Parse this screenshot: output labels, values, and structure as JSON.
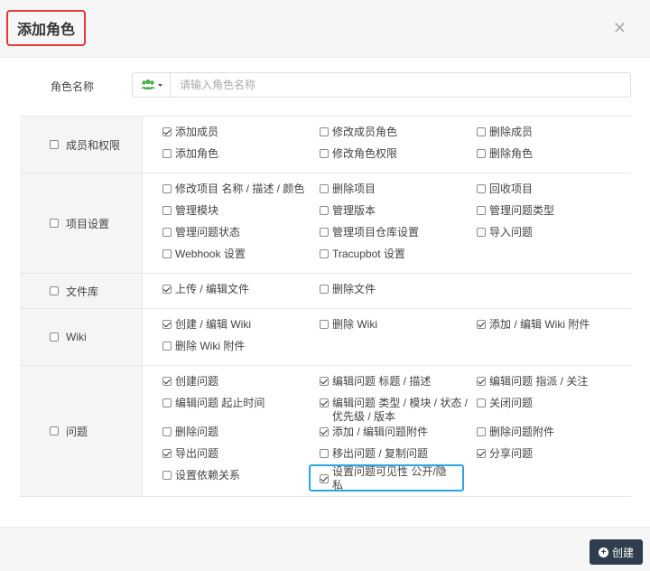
{
  "dialog": {
    "title": "添加角色",
    "close_glyph": "✕",
    "role_name_label": "角色名称",
    "role_name_value": "",
    "role_name_placeholder": "请输入角色名称",
    "icon_color": "#4caf50",
    "create_label": "创建"
  },
  "permissions": [
    {
      "category": "成员和权限",
      "checked": false,
      "items": [
        {
          "label": "添加成员",
          "checked": true
        },
        {
          "label": "修改成员角色",
          "checked": false
        },
        {
          "label": "删除成员",
          "checked": false
        },
        {
          "label": "添加角色",
          "checked": false
        },
        {
          "label": "修改角色权限",
          "checked": false
        },
        {
          "label": "删除角色",
          "checked": false
        }
      ]
    },
    {
      "category": "项目设置",
      "checked": false,
      "items": [
        {
          "label": "修改项目 名称 / 描述 / 颜色",
          "checked": false
        },
        {
          "label": "删除项目",
          "checked": false
        },
        {
          "label": "回收项目",
          "checked": false
        },
        {
          "label": "管理模块",
          "checked": false
        },
        {
          "label": "管理版本",
          "checked": false
        },
        {
          "label": "管理问题类型",
          "checked": false
        },
        {
          "label": "管理问题状态",
          "checked": false
        },
        {
          "label": "管理项目仓库设置",
          "checked": false
        },
        {
          "label": "导入问题",
          "checked": false
        },
        {
          "label": "Webhook 设置",
          "checked": false
        },
        {
          "label": "Tracupbot 设置",
          "checked": false
        }
      ]
    },
    {
      "category": "文件库",
      "checked": false,
      "items": [
        {
          "label": "上传 / 编辑文件",
          "checked": true
        },
        {
          "label": "删除文件",
          "checked": false
        }
      ]
    },
    {
      "category": "Wiki",
      "checked": false,
      "items": [
        {
          "label": "创建 / 编辑 Wiki",
          "checked": true
        },
        {
          "label": "删除 Wiki",
          "checked": false
        },
        {
          "label": "添加 / 编辑 Wiki 附件",
          "checked": true
        },
        {
          "label": "删除 Wiki 附件",
          "checked": false
        }
      ]
    },
    {
      "category": "问题",
      "checked": false,
      "items": [
        {
          "label": "创建问题",
          "checked": true
        },
        {
          "label": "编辑问题 标题 / 描述",
          "checked": true
        },
        {
          "label": "编辑问题 指派 / 关注",
          "checked": true
        },
        {
          "label": "编辑问题 起止时间",
          "checked": false
        },
        {
          "label": "编辑问题 类型 / 模块 / 状态 / 优先级 / 版本",
          "checked": true
        },
        {
          "label": "关闭问题",
          "checked": false
        },
        {
          "label": "删除问题",
          "checked": false
        },
        {
          "label": "添加 / 编辑问题附件",
          "checked": true
        },
        {
          "label": "删除问题附件",
          "checked": false
        },
        {
          "label": "导出问题",
          "checked": true
        },
        {
          "label": "移出问题 / 复制问题",
          "checked": false
        },
        {
          "label": "分享问题",
          "checked": true
        },
        {
          "label": "设置依赖关系",
          "checked": false
        },
        {
          "label": "设置问题可见性 公开/隐私",
          "checked": true,
          "highlighted": true
        }
      ]
    }
  ],
  "colors": {
    "title_outline": "#e53935",
    "highlight_outline": "#29a6e0",
    "create_button_bg": "#2f3e4e"
  }
}
